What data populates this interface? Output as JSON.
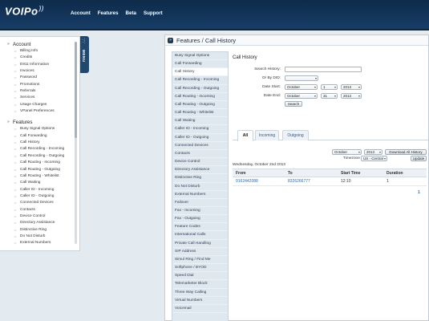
{
  "brand": {
    "logo_text": "VOIPo",
    "logo_wave": "))"
  },
  "nav": {
    "items": [
      "Account",
      "Features",
      "Beta",
      "Support"
    ]
  },
  "left_menu": {
    "tab_label": "MENU",
    "groups": [
      {
        "title": "Account",
        "items": [
          "Billing Info",
          "Credits",
          "E911 Information",
          "Invoices",
          "Password",
          "Promotions",
          "Referrals",
          "Services",
          "Usage Charges",
          "VPanel Preferences"
        ]
      },
      {
        "title": "Features",
        "items": [
          "Busy Signal Options",
          "Call Forwarding",
          "Call History",
          "Call Recording - Incoming",
          "Call Recording - Outgoing",
          "Call Routing - Incoming",
          "Call Routing - Outgoing",
          "Call Routing - Whitelist",
          "Call Waiting",
          "Caller ID - Incoming",
          "Caller ID - Outgoing",
          "Connected Devices",
          "Contacts",
          "Device Control",
          "Directory Assistance",
          "Distinctive Ring",
          "Do Not Disturb",
          "External Numbers"
        ]
      }
    ]
  },
  "panel": {
    "title": "Features / Call History"
  },
  "subnav": {
    "active": "Call History",
    "items": [
      "Busy Signal Options",
      "Call Forwarding",
      "Call History",
      "Call Recording - Incoming",
      "Call Recording - Outgoing",
      "Call Routing - Incoming",
      "Call Routing - Outgoing",
      "Call Routing - Whitelist",
      "Call Waiting",
      "Caller ID - Incoming",
      "Caller ID - Outgoing",
      "Connected Devices",
      "Contacts",
      "Device Control",
      "Directory Assistance",
      "Distinctive Ring",
      "Do Not Disturb",
      "External Numbers",
      "Failover",
      "Fax - Incoming",
      "Fax - Outgoing",
      "Feature Codes",
      "International Calls",
      "Private Call Handling",
      "SIP Address",
      "Simul Ring / Find Me",
      "Softphone / BYOD",
      "Speed Dial",
      "Telemarketer Block",
      "Three Way Calling",
      "Virtual Numbers",
      "Voicemail"
    ]
  },
  "form": {
    "section_title": "Call History",
    "search_label": "Search History:",
    "search_value": "",
    "did_label": "Or By DID:",
    "did_value": "",
    "start_label": "Date Start:",
    "start_month": "October",
    "start_day": "1",
    "start_year": "2013",
    "end_label": "Date End:",
    "end_month": "October",
    "end_day": "31",
    "end_year": "2013",
    "search_button": "Search"
  },
  "tabs": [
    "All",
    "Incoming",
    "Outgoing"
  ],
  "active_tab": "All",
  "toolbar": {
    "month": "October",
    "year": "2013",
    "download_button": "Download All History",
    "timezone_label": "Timezone",
    "timezone_value": "US - Central",
    "update_button": "Update"
  },
  "results": {
    "date_heading": "Wednesday, October 2nd 2013",
    "columns": [
      "From",
      "To",
      "Start Time",
      "Duration"
    ],
    "rows": [
      [
        "9162442088",
        "8326266777",
        "12:10",
        "1"
      ]
    ],
    "page": "1"
  }
}
